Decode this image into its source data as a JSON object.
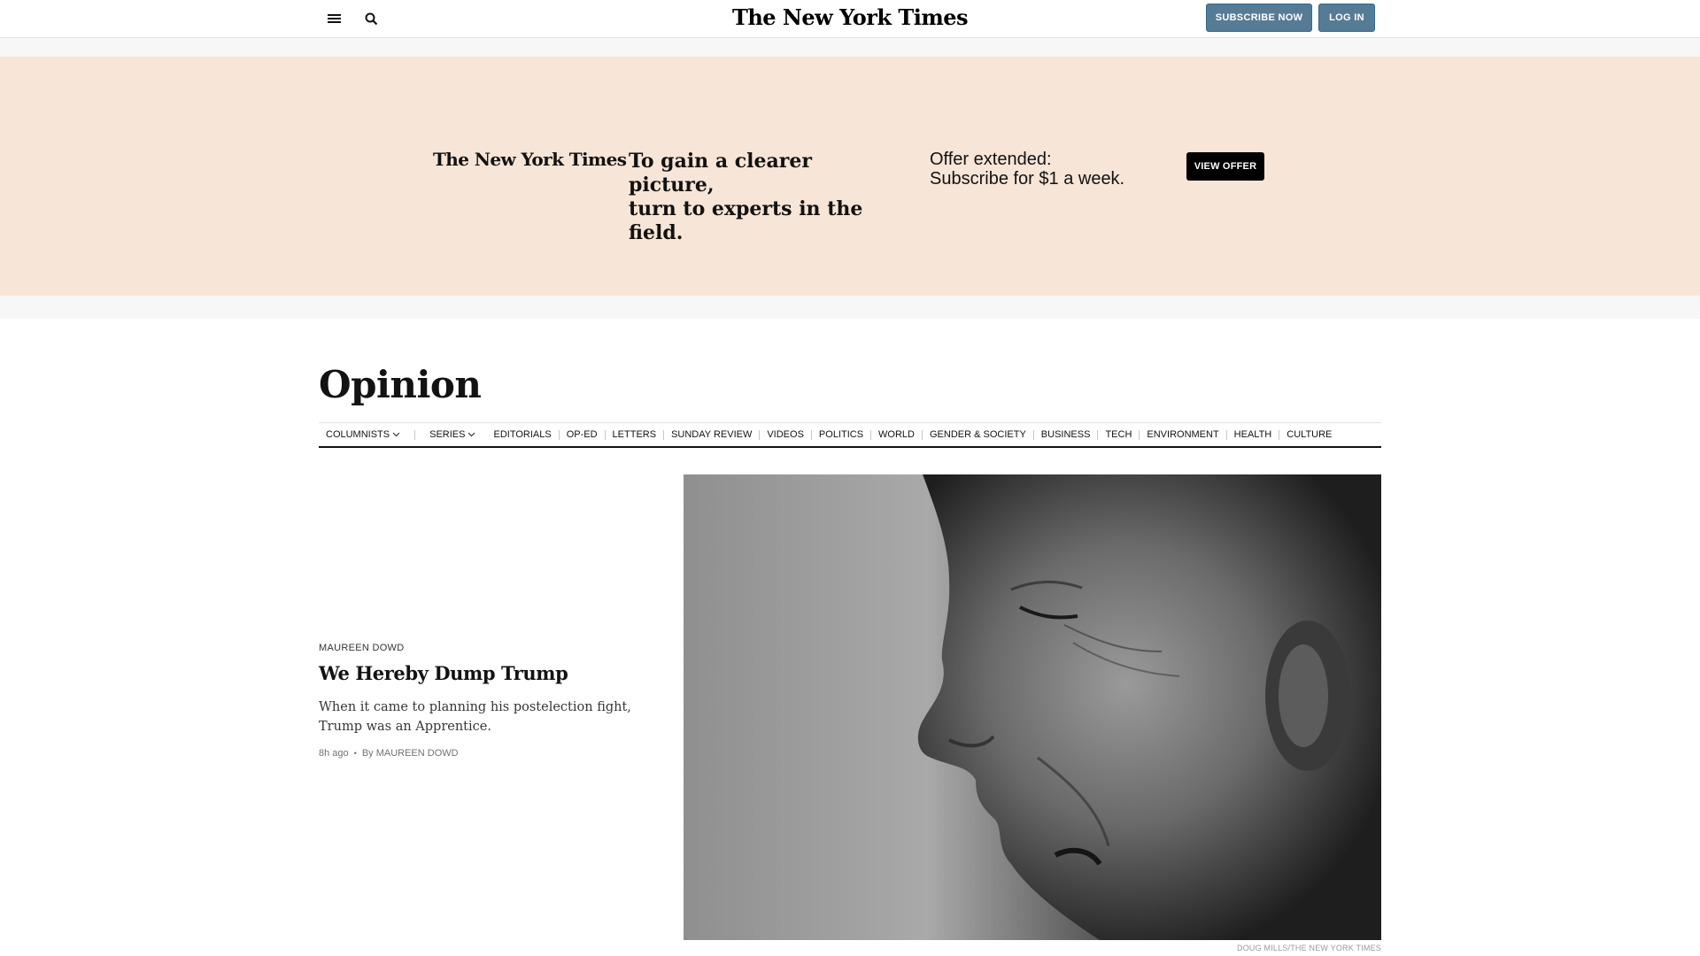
{
  "masthead": {
    "logo": "The New York Times",
    "subscribe_label": "SUBSCRIBE NOW",
    "login_label": "LOG IN",
    "icons": [
      "menu-icon",
      "search-icon"
    ]
  },
  "promo": {
    "logo": "The New York Times",
    "headline_line1": "To gain a clearer picture,",
    "headline_line2": "turn to experts in the field.",
    "offer_line1": "Offer extended:",
    "offer_line2": "Subscribe for $1 a week.",
    "cta": "VIEW OFFER",
    "background": "#f7e5d7"
  },
  "section": {
    "title": "Opinion"
  },
  "subnav": {
    "dropdowns": [
      {
        "label": "COLUMNISTS",
        "icon": "chevron-down-icon"
      },
      {
        "label": "SERIES",
        "icon": "chevron-down-icon"
      }
    ],
    "links": [
      "EDITORIALS",
      "OP-ED",
      "LETTERS",
      "SUNDAY REVIEW",
      "VIDEOS",
      "POLITICS",
      "WORLD",
      "GENDER & SOCIETY",
      "BUSINESS",
      "TECH",
      "ENVIRONMENT",
      "HEALTH",
      "CULTURE"
    ]
  },
  "lead_story": {
    "kicker": "MAUREEN DOWD",
    "headline": "We Hereby Dump Trump",
    "summary": "When it came to planning his postelection fight, Trump was an Apprentice.",
    "time": "8h ago",
    "byline": "By MAUREEN DOWD",
    "image_credit": "DOUG MILLS/THE NEW YORK TIMES"
  }
}
